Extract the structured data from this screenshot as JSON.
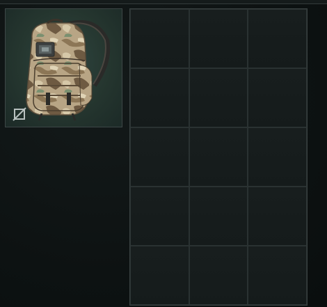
{
  "equipment_slot": {
    "item": "backpack",
    "icon_bottom_left": "slot-unavailable-icon"
  },
  "container_grid": {
    "columns": 3,
    "rows": 5,
    "cells": [
      {
        "filled": false
      },
      {
        "filled": false
      },
      {
        "filled": false
      },
      {
        "filled": false
      },
      {
        "filled": false
      },
      {
        "filled": false
      },
      {
        "filled": false
      },
      {
        "filled": false
      },
      {
        "filled": false
      },
      {
        "filled": false
      },
      {
        "filled": false
      },
      {
        "filled": false
      },
      {
        "filled": false
      },
      {
        "filled": false
      },
      {
        "filled": false
      }
    ]
  },
  "colors": {
    "background": "#0d1212",
    "slot_background": "#25362f",
    "grid_line": "#2a3232",
    "camo_light": "#c9b898",
    "camo_dark": "#6b5a45"
  }
}
